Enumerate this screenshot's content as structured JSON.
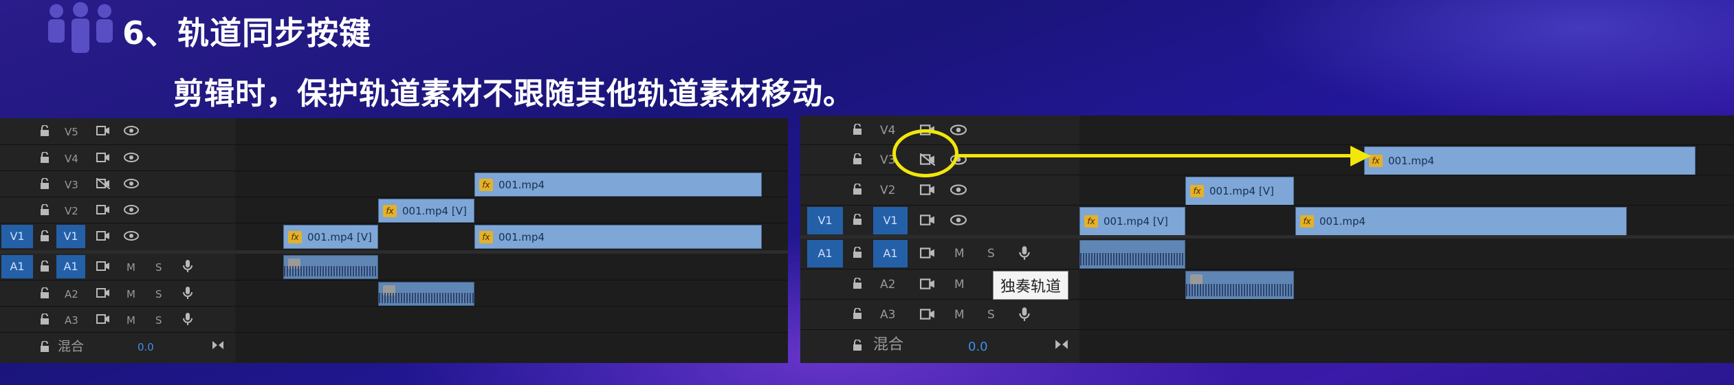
{
  "slide": {
    "title": "6、轨道同步按键",
    "subtitle": "剪辑时，保护轨道素材不跟随其他轨道素材移动。",
    "accent_color": "#f2e60b"
  },
  "left_timeline": {
    "video_tracks": [
      "V5",
      "V4",
      "V3",
      "V2",
      "V1"
    ],
    "audio_tracks": [
      "A1",
      "A2",
      "A3"
    ],
    "source_v1": "V1",
    "source_a1": "A1",
    "audio_buttons": {
      "mute": "M",
      "solo": "S"
    },
    "mix_label": "混合",
    "mix_value": "0.0",
    "clips": {
      "v3": "001.mp4",
      "v2": "001.mp4 [V]",
      "v1_a": "001.mp4 [V]",
      "v1_b": "001.mp4"
    }
  },
  "right_timeline": {
    "video_tracks": [
      "V4",
      "V3",
      "V2",
      "V1"
    ],
    "audio_tracks": [
      "A1",
      "A2",
      "A3"
    ],
    "source_v1": "V1",
    "source_a1": "A1",
    "audio_buttons": {
      "mute": "M",
      "solo": "S"
    },
    "mix_label": "混合",
    "mix_value": "0.0",
    "tooltip": "独奏轨道",
    "clips": {
      "v3": "001.mp4",
      "v2": "001.mp4 [V]",
      "v1_a": "001.mp4 [V]",
      "v1_b": "001.mp4"
    }
  }
}
